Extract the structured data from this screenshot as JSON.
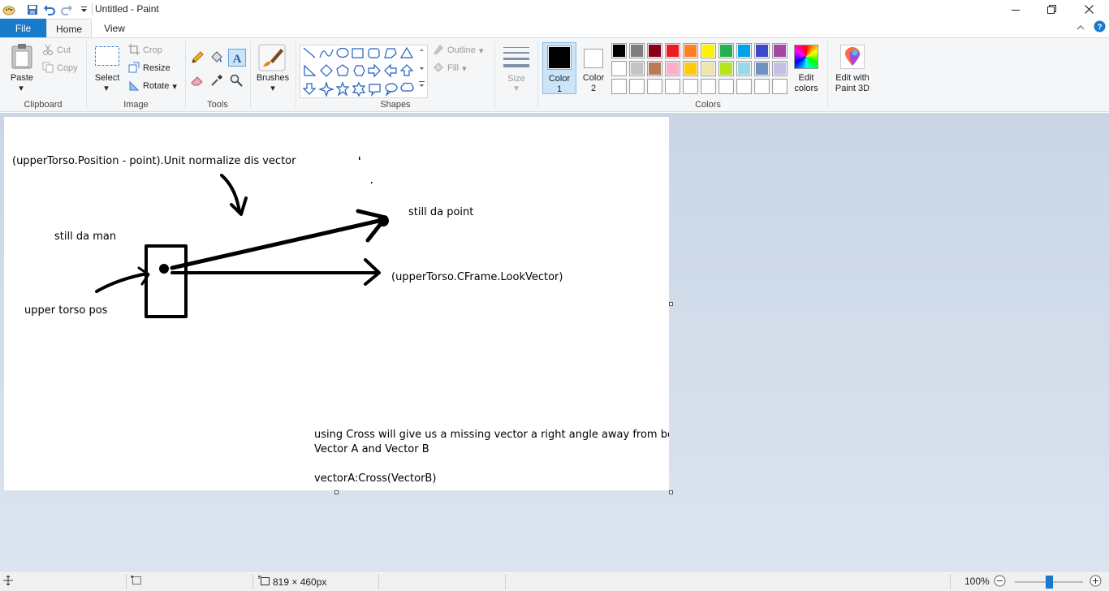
{
  "app": {
    "title": "Untitled - Paint"
  },
  "tabs": {
    "file": "File",
    "home": "Home",
    "view": "View"
  },
  "ribbon": {
    "clipboard": {
      "label": "Clipboard",
      "paste": "Paste",
      "cut": "Cut",
      "copy": "Copy"
    },
    "image": {
      "label": "Image",
      "select": "Select",
      "crop": "Crop",
      "resize": "Resize",
      "rotate": "Rotate"
    },
    "tools": {
      "label": "Tools"
    },
    "brushes": {
      "label": "Brushes"
    },
    "shapes": {
      "label": "Shapes",
      "outline": "Outline",
      "fill": "Fill"
    },
    "size": {
      "label": "Size"
    },
    "colors": {
      "label": "Colors",
      "color1": [
        "Color",
        "1"
      ],
      "color2": [
        "Color",
        "2"
      ],
      "edit_colors": [
        "Edit",
        "colors"
      ],
      "paint3d": [
        "Edit with",
        "Paint 3D"
      ],
      "color1_value": "#000000",
      "color2_value": "#ffffff",
      "palette_row1": [
        "#000000",
        "#7f7f7f",
        "#880015",
        "#ed1c24",
        "#ff7f27",
        "#fff200",
        "#22b14c",
        "#00a2e8",
        "#3f48cc",
        "#a349a4"
      ],
      "palette_row2": [
        "#ffffff",
        "#c3c3c3",
        "#b97a57",
        "#ffaec9",
        "#ffc90e",
        "#efe4b0",
        "#b5e61d",
        "#99d9ea",
        "#7092be",
        "#c8bfe7"
      ],
      "palette_row3": [
        "#ffffff",
        "#ffffff",
        "#ffffff",
        "#ffffff",
        "#ffffff",
        "#ffffff",
        "#ffffff",
        "#ffffff",
        "#ffffff",
        "#ffffff"
      ]
    }
  },
  "canvas": {
    "texts": {
      "t1": "(upperTorso.Position - point).Unit normalize dis vector",
      "t2": "still da point",
      "t3": "still da man",
      "t4": "(upperTorso.CFrame.LookVector)",
      "t5": "upper torso pos",
      "t6": "using Cross will give us a missing vector a right angle away from both",
      "t7": "Vector A and Vector B",
      "t8": "vectorA:Cross(VectorB)"
    }
  },
  "status": {
    "dimensions": "819 × 460px",
    "zoom": "100%"
  }
}
